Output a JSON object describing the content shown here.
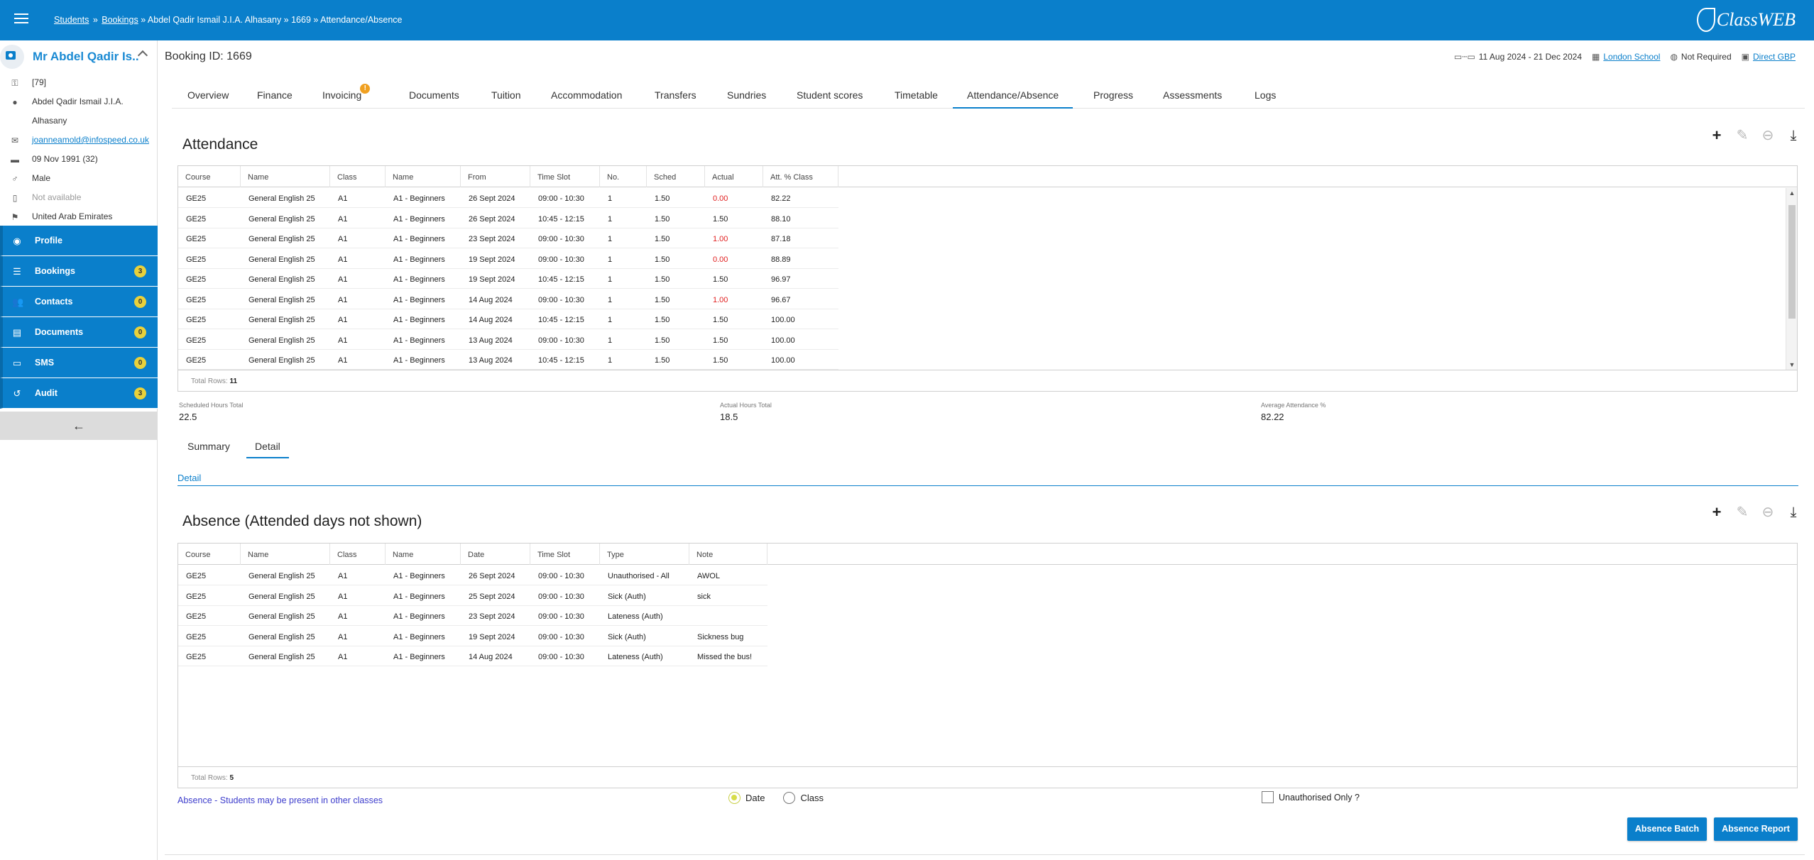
{
  "topbar": {
    "breadcrumb": {
      "students": "Students",
      "sep1": "»",
      "bookings": "Bookings",
      "rest": "» Abdel Qadir Ismail J.I.A. Alhasany » 1669 » Attendance/Absence"
    },
    "logo_text": "ClassWEB"
  },
  "sidebar": {
    "profile_name": "Mr Abdel Qadir Is...",
    "info": {
      "id": "[79]",
      "name1": "Abdel Qadir Ismail J.I.A.",
      "name2": "Alhasany",
      "email": "joanneamold@infospeed.co.uk",
      "dob": "09 Nov 1991 (32)",
      "gender": "Male",
      "phone": "Not available",
      "nationality": "United Arab Emirates"
    },
    "nav": [
      {
        "label": "Profile",
        "badge": ""
      },
      {
        "label": "Bookings",
        "badge": "3"
      },
      {
        "label": "Contacts",
        "badge": "0"
      },
      {
        "label": "Documents",
        "badge": "0"
      },
      {
        "label": "SMS",
        "badge": "0"
      },
      {
        "label": "Audit",
        "badge": "3"
      }
    ]
  },
  "header": {
    "booking_id": "Booking ID: 1669",
    "dates": "11 Aug 2024 - 21 Dec 2024",
    "school": "London School",
    "accommodation": "Not Required",
    "agent": "Direct GBP"
  },
  "tabs": [
    {
      "label": "Overview"
    },
    {
      "label": "Finance"
    },
    {
      "label": "Invoicing",
      "badge": "!"
    },
    {
      "label": "Documents"
    },
    {
      "label": "Tuition"
    },
    {
      "label": "Accommodation"
    },
    {
      "label": "Transfers"
    },
    {
      "label": "Sundries"
    },
    {
      "label": "Student scores"
    },
    {
      "label": "Timetable"
    },
    {
      "label": "Attendance/Absence"
    },
    {
      "label": "Progress"
    },
    {
      "label": "Assessments"
    },
    {
      "label": "Logs"
    }
  ],
  "attendance": {
    "title": "Attendance",
    "columns": [
      "Course",
      "Name",
      "Class",
      "Name",
      "From",
      "Time Slot",
      "No.",
      "Sched",
      "Actual",
      "Att. % Class"
    ],
    "rows": [
      [
        "GE25",
        "General English 25",
        "A1",
        "A1 - Beginners",
        "26 Sept 2024",
        "09:00 - 10:30",
        "1",
        "1.50",
        "0.00",
        "82.22"
      ],
      [
        "GE25",
        "General English 25",
        "A1",
        "A1 - Beginners",
        "26 Sept 2024",
        "10:45 - 12:15",
        "1",
        "1.50",
        "1.50",
        "88.10"
      ],
      [
        "GE25",
        "General English 25",
        "A1",
        "A1 - Beginners",
        "23 Sept 2024",
        "09:00 - 10:30",
        "1",
        "1.50",
        "1.00",
        "87.18"
      ],
      [
        "GE25",
        "General English 25",
        "A1",
        "A1 - Beginners",
        "19 Sept 2024",
        "09:00 - 10:30",
        "1",
        "1.50",
        "0.00",
        "88.89"
      ],
      [
        "GE25",
        "General English 25",
        "A1",
        "A1 - Beginners",
        "19 Sept 2024",
        "10:45 - 12:15",
        "1",
        "1.50",
        "1.50",
        "96.97"
      ],
      [
        "GE25",
        "General English 25",
        "A1",
        "A1 - Beginners",
        "14 Aug 2024",
        "09:00 - 10:30",
        "1",
        "1.50",
        "1.00",
        "96.67"
      ],
      [
        "GE25",
        "General English 25",
        "A1",
        "A1 - Beginners",
        "14 Aug 2024",
        "10:45 - 12:15",
        "1",
        "1.50",
        "1.50",
        "100.00"
      ],
      [
        "GE25",
        "General English 25",
        "A1",
        "A1 - Beginners",
        "13 Aug 2024",
        "09:00 - 10:30",
        "1",
        "1.50",
        "1.50",
        "100.00"
      ],
      [
        "GE25",
        "General English 25",
        "A1",
        "A1 - Beginners",
        "13 Aug 2024",
        "10:45 - 12:15",
        "1",
        "1.50",
        "1.50",
        "100.00"
      ]
    ],
    "red_actual_rows": [
      0,
      2,
      3,
      5
    ],
    "total_rows_label": "Total Rows:",
    "total_rows": "11"
  },
  "totals": {
    "scheduled_label": "Scheduled Hours Total",
    "scheduled_value": "22.5",
    "actual_label": "Actual Hours Total",
    "actual_value": "18.5",
    "average_label": "Average Attendance %",
    "average_value": "82.22"
  },
  "subtabs": [
    {
      "label": "Summary"
    },
    {
      "label": "Detail"
    }
  ],
  "detail_link": "Detail",
  "absence": {
    "title": "Absence (Attended days not shown)",
    "columns": [
      "Course",
      "Name",
      "Class",
      "Name",
      "Date",
      "Time Slot",
      "Type",
      "Note"
    ],
    "rows": [
      [
        "GE25",
        "General English 25",
        "A1",
        "A1 - Beginners",
        "26 Sept 2024",
        "09:00 - 10:30",
        "Unauthorised - All",
        "AWOL"
      ],
      [
        "GE25",
        "General English 25",
        "A1",
        "A1 - Beginners",
        "25 Sept 2024",
        "09:00 - 10:30",
        "Sick (Auth)",
        "sick"
      ],
      [
        "GE25",
        "General English 25",
        "A1",
        "A1 - Beginners",
        "23 Sept 2024",
        "09:00 - 10:30",
        "Lateness (Auth)",
        ""
      ],
      [
        "GE25",
        "General English 25",
        "A1",
        "A1 - Beginners",
        "19 Sept 2024",
        "09:00 - 10:30",
        "Sick (Auth)",
        "Sickness bug"
      ],
      [
        "GE25",
        "General English 25",
        "A1",
        "A1 - Beginners",
        "14 Aug 2024",
        "09:00 - 10:30",
        "Lateness (Auth)",
        "Missed the bus!"
      ]
    ],
    "total_rows_label": "Total Rows:",
    "total_rows": "5"
  },
  "footer": {
    "note": "Absence - Students may be present in other classes",
    "radio_date": "Date",
    "radio_class": "Class",
    "radio_selected": "Date",
    "checkbox_label": "Unauthorised Only ?",
    "checkbox_checked": false,
    "btn_batch": "Absence Batch",
    "btn_report": "Absence Report"
  },
  "colors": {
    "primary": "#0a7fcb",
    "badge": "#e9d13b",
    "warning_dot": "#f0a020",
    "negative": "#e02020"
  }
}
